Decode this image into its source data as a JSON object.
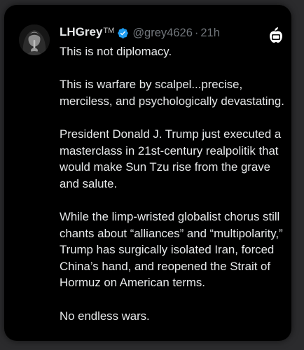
{
  "post": {
    "display_name": "LHGrey",
    "name_suffix": "TM",
    "handle": "@grey4626",
    "separator": "·",
    "timestamp": "21h",
    "paragraphs": [
      "This is not diplomacy.",
      "This is warfare by scalpel...precise, merciless, and psychologically devastating.",
      "President Donald J. Trump just executed a masterclass in 21st-century realpolitik that would make Sun Tzu rise from the grave and salute.",
      "While the limp-wristed globalist chorus still chants about “alliances” and “multipolarity,” Trump has surgically isolated Iran, forced China’s hand, and reopened the Strait of Hormuz on American terms.",
      "No endless wars."
    ]
  },
  "icons": {
    "verified": "verified-badge-icon",
    "app": "app-logo-icon"
  },
  "colors": {
    "background": "#000000",
    "text": "#e7e9ea",
    "secondary_text": "#71767b",
    "verified_blue": "#1d9bf0"
  }
}
